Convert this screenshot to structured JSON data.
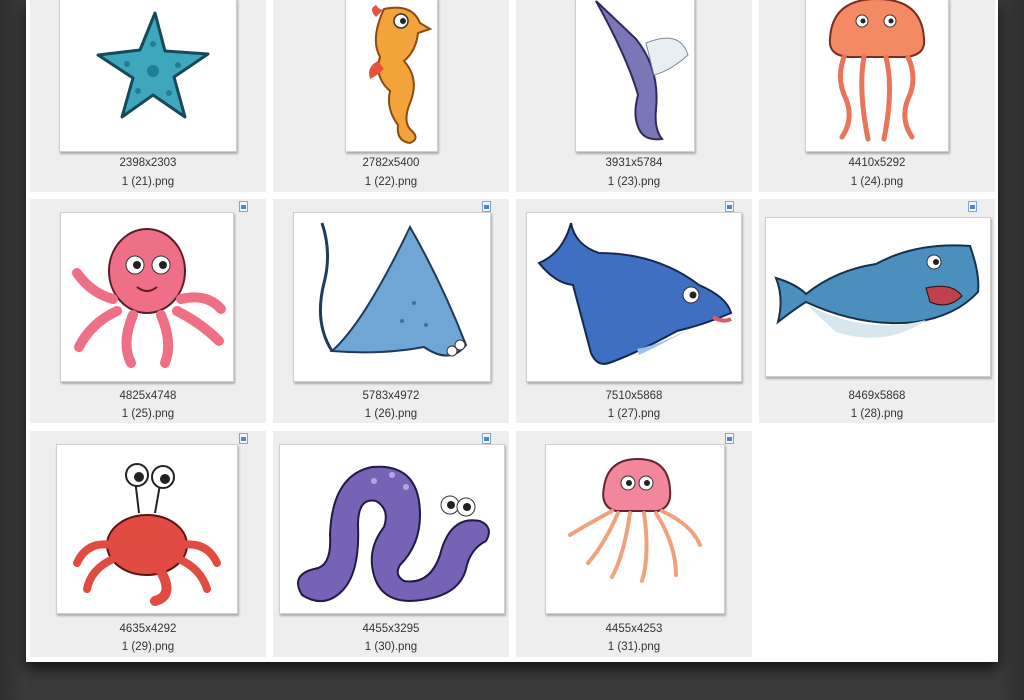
{
  "explorer": {
    "items": [
      {
        "name": "1 (21).png",
        "dims": "2398x2303",
        "icon": "starfish"
      },
      {
        "name": "1 (22).png",
        "dims": "2782x5400",
        "icon": "seahorse"
      },
      {
        "name": "1 (23).png",
        "dims": "3931x5784",
        "icon": "swordfish"
      },
      {
        "name": "1 (24).png",
        "dims": "4410x5292",
        "icon": "jellyfish-red"
      },
      {
        "name": "1 (25).png",
        "dims": "4825x4748",
        "icon": "octopus"
      },
      {
        "name": "1 (26).png",
        "dims": "5783x4972",
        "icon": "stingray"
      },
      {
        "name": "1 (27).png",
        "dims": "7510x5868",
        "icon": "dolphin"
      },
      {
        "name": "1 (28).png",
        "dims": "8469x5868",
        "icon": "shark"
      },
      {
        "name": "1 (29).png",
        "dims": "4635x4292",
        "icon": "crab"
      },
      {
        "name": "1 (30).png",
        "dims": "4455x3295",
        "icon": "eel"
      },
      {
        "name": "1 (31).png",
        "dims": "4455x4253",
        "icon": "jellyfish-pink"
      }
    ]
  }
}
